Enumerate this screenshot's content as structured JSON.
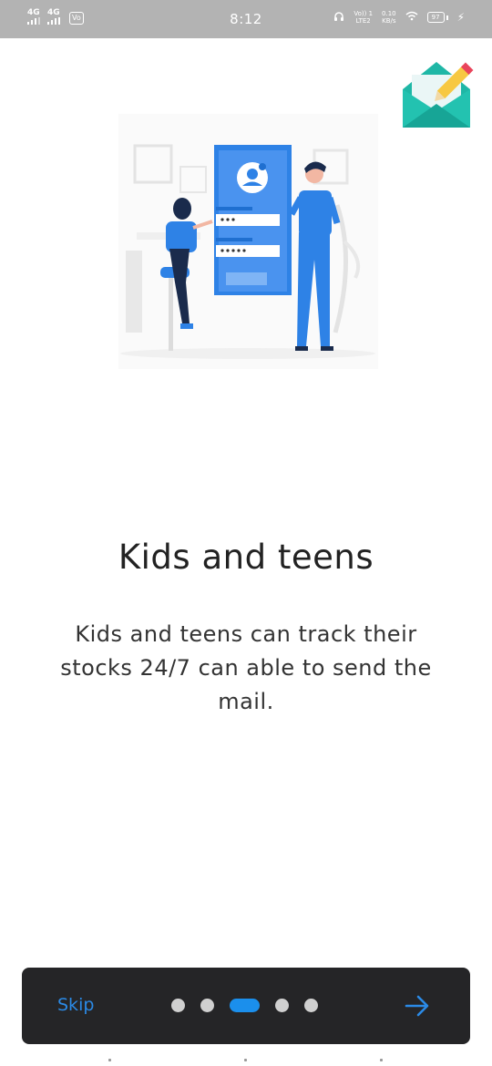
{
  "status_bar": {
    "sim1": "4G",
    "sim2": "4G",
    "volte": "Vo",
    "time": "8:12",
    "network_line1": "Vo)) 1",
    "network_line2": "LTE2",
    "speed_value": "0.10",
    "speed_unit": "KB/s",
    "battery": "97"
  },
  "onboarding": {
    "title": "Kids and teens",
    "description": "Kids and teens can track their stocks 24/7 can able to send the mail."
  },
  "nav": {
    "skip_label": "Skip",
    "page_count": 5,
    "active_index": 2
  },
  "colors": {
    "accent": "#1b8fec",
    "nav_background": "#252527",
    "dot_inactive": "#d0d0d0",
    "status_bar": "#b3b3b3"
  },
  "icons": {
    "logo": "mail-pencil-icon",
    "next": "arrow-right-icon"
  }
}
